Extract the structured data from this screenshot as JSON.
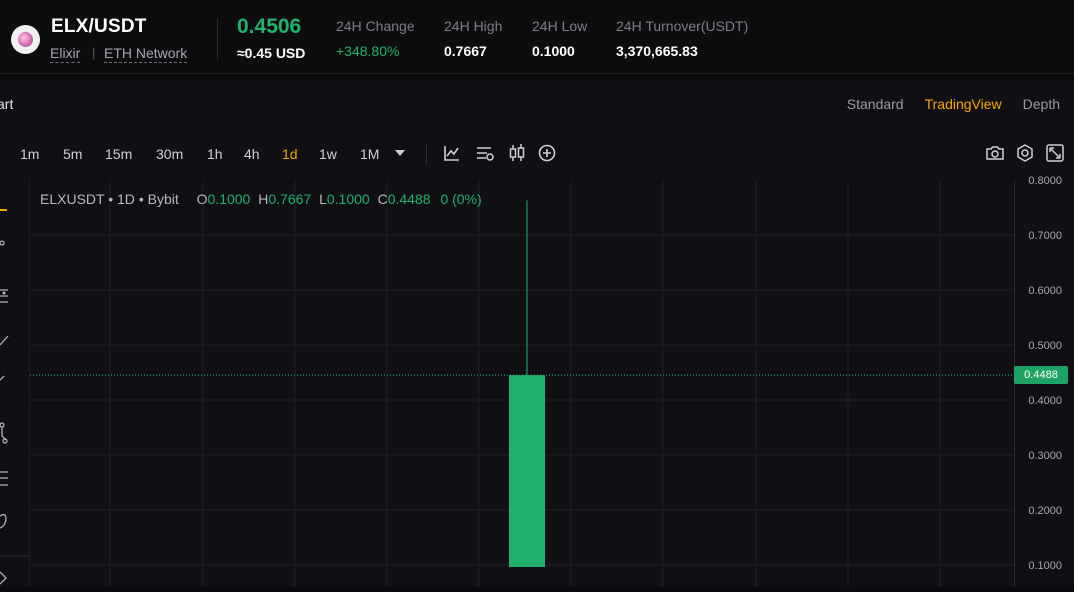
{
  "header": {
    "pair": "ELX/USDT",
    "project": "Elixir",
    "separator": "|",
    "network": "ETH Network",
    "last_price": "0.4506",
    "usd_equiv": "≈0.45 USD",
    "stats": [
      {
        "label": "24H Change",
        "value": "+348.80%"
      },
      {
        "label": "24H High",
        "value": "0.7667"
      },
      {
        "label": "24H Low",
        "value": "0.1000"
      },
      {
        "label": "24H Turnover(USDT)",
        "value": "3,370,665.83"
      }
    ]
  },
  "panel": {
    "title": "art",
    "view_tabs": [
      "Standard",
      "TradingView",
      "Depth"
    ],
    "active_view": "TradingView"
  },
  "toolbar": {
    "timeframes": [
      "1m",
      "5m",
      "15m",
      "30m",
      "1h",
      "4h",
      "1d",
      "1w",
      "1M"
    ],
    "active_timeframe": "1d",
    "dropdown_icon": "caret-down-icon",
    "left_icons": [
      "indicator-chart-icon",
      "chart-settings-icon",
      "candlestick-icon",
      "add-circle-icon"
    ],
    "right_icons": [
      "camera-icon",
      "gear-hex-icon",
      "fullscreen-icon"
    ]
  },
  "legend": {
    "symbol": "ELXUSDT",
    "interval": "1D",
    "exchange": "Bybit",
    "o_label": "O",
    "o_value": "0.1000",
    "h_label": "H",
    "h_value": "0.7667",
    "l_label": "L",
    "l_value": "0.1000",
    "c_label": "C",
    "c_value": "0.4488",
    "change": "0 (0%)"
  },
  "price_axis": {
    "ticks": [
      "0.8000",
      "0.7000",
      "0.6000",
      "0.5000",
      "0.4000",
      "0.3000",
      "0.2000",
      "0.1000"
    ],
    "current_price_tag": "0.4488"
  },
  "chart_data": {
    "type": "candlestick",
    "ylim": [
      0.1,
      0.8
    ],
    "candles": [
      {
        "open": 0.1,
        "high": 0.7667,
        "low": 0.1,
        "close": 0.4488
      }
    ],
    "colors": {
      "up": "#20b26c",
      "background": "#101014",
      "grid": "#1e1e23"
    }
  }
}
